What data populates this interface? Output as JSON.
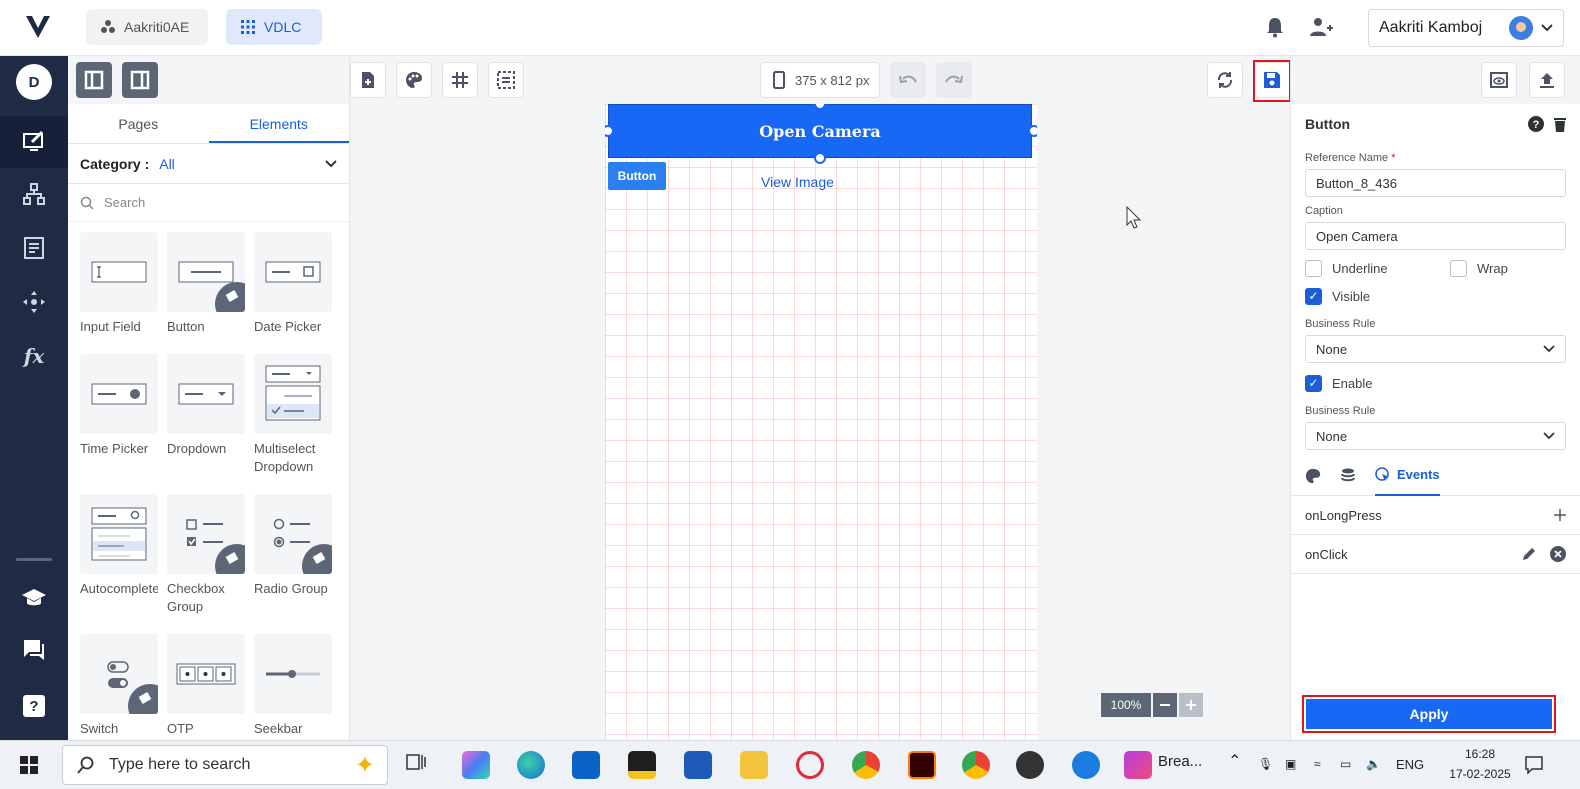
{
  "header": {
    "workspace": "Aakriti0AE",
    "app": "VDLC",
    "user": "Aakriti Kamboj"
  },
  "nav": {
    "avatar_letter": "D"
  },
  "left_panel": {
    "tabs": [
      "Pages",
      "Elements"
    ],
    "active_tab": "Elements",
    "category_label": "Category :",
    "category_value": "All",
    "search_placeholder": "Search",
    "elements": [
      {
        "label": "Input Field"
      },
      {
        "label": "Button"
      },
      {
        "label": "Date Picker"
      },
      {
        "label": "Time Picker"
      },
      {
        "label": "Dropdown"
      },
      {
        "label": "Multiselect Dropdown"
      },
      {
        "label": "Autocomplete"
      },
      {
        "label": "Checkbox Group"
      },
      {
        "label": "Radio Group"
      },
      {
        "label": "Switch"
      },
      {
        "label": "OTP"
      },
      {
        "label": "Seekbar"
      }
    ]
  },
  "canvas": {
    "device_size": "375 x 812 px",
    "open_camera": "Open Camera",
    "button_label": "Button",
    "view_image": "View Image",
    "zoom": "100%"
  },
  "properties": {
    "title": "Button",
    "reference_name_label": "Reference Name",
    "reference_name": "Button_8_436",
    "caption_label": "Caption",
    "caption": "Open Camera",
    "underline": "Underline",
    "wrap": "Wrap",
    "visible": "Visible",
    "business_rule_label": "Business Rule",
    "business_rule_1": "None",
    "enable": "Enable",
    "business_rule_2": "None",
    "events_tab": "Events",
    "events": [
      {
        "name": "onLongPress"
      },
      {
        "name": "onClick"
      }
    ],
    "apply": "Apply"
  },
  "taskbar": {
    "search_placeholder": "Type here to search",
    "app_label": "Brea...",
    "language": "ENG",
    "time": "16:28",
    "date": "17-02-2025"
  },
  "colors": {
    "primary": "#1769f5",
    "rail": "#1f2a44",
    "highlight": "#e0161d"
  }
}
